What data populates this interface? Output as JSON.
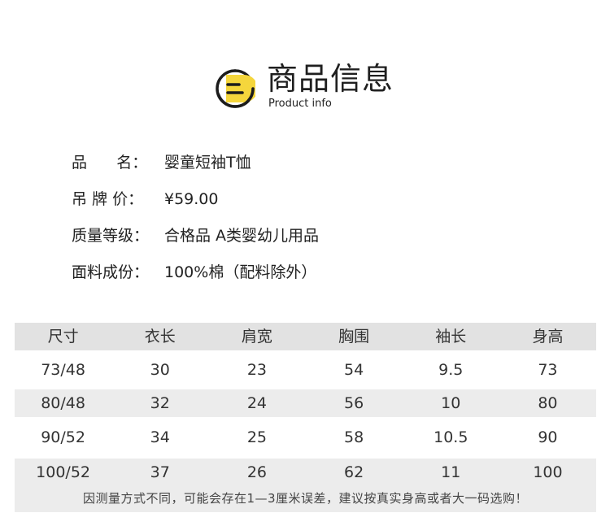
{
  "header": {
    "title": "商品信息",
    "subtitle": "Product info"
  },
  "info": [
    {
      "label": "品      名：",
      "value": "婴童短袖T恤"
    },
    {
      "label": "吊 牌 价：",
      "value": "¥59.00"
    },
    {
      "label": "质量等级：",
      "value": "合格品 A类婴幼儿用品"
    },
    {
      "label": "面料成份：",
      "value": "100%棉（配料除外）"
    }
  ],
  "size_table": {
    "headers": [
      "尺寸",
      "衣长",
      "肩宽",
      "胸围",
      "袖长",
      "身高"
    ],
    "rows": [
      [
        "73/48",
        "30",
        "23",
        "54",
        "9.5",
        "73"
      ],
      [
        "80/48",
        "32",
        "24",
        "56",
        "10",
        "80"
      ],
      [
        "90/52",
        "34",
        "25",
        "58",
        "10.5",
        "90"
      ],
      [
        "100/52",
        "37",
        "26",
        "62",
        "11",
        "100"
      ]
    ]
  },
  "note": "因测量方式不同，可能会存在1—3厘米误差，建议按真实身高或者大一码选购！",
  "colors": {
    "logo_yellow": "#f5d63c",
    "logo_dark": "#1c1c1c",
    "table_shade": "#ececec",
    "table_header": "#e2e2e2"
  }
}
